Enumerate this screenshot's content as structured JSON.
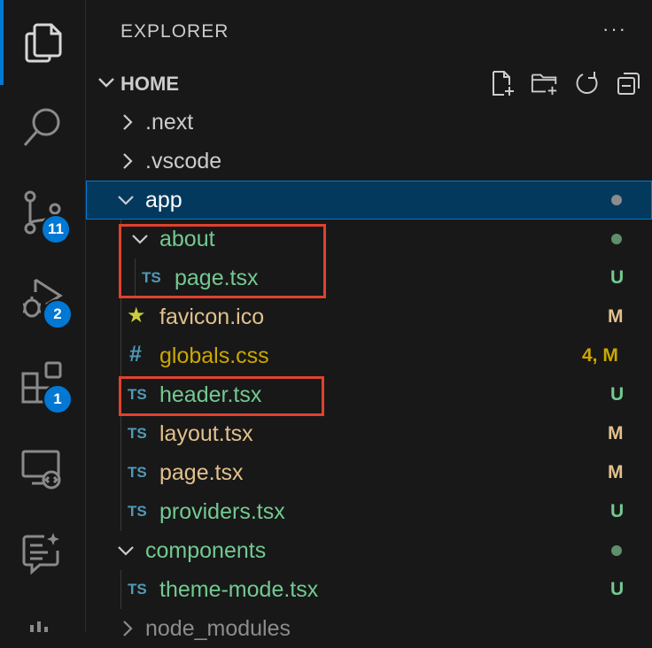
{
  "activity_bar": {
    "items": [
      {
        "name": "explorer",
        "icon": "files-icon",
        "badge": null,
        "active": true
      },
      {
        "name": "search",
        "icon": "search-icon",
        "badge": null
      },
      {
        "name": "source-control",
        "icon": "source-control-icon",
        "badge": "11"
      },
      {
        "name": "run-debug",
        "icon": "run-debug-icon",
        "badge": "2"
      },
      {
        "name": "extensions",
        "icon": "extensions-icon",
        "badge": "1"
      },
      {
        "name": "remote-explorer",
        "icon": "remote-explorer-icon",
        "badge": null
      },
      {
        "name": "chat",
        "icon": "chat-sparkle-icon",
        "badge": null
      }
    ]
  },
  "sidebar": {
    "title": "EXPLORER",
    "more": "···",
    "section": {
      "title": "HOME",
      "actions": [
        "new-file-icon",
        "new-folder-icon",
        "refresh-icon",
        "collapse-all-icon"
      ]
    },
    "tree": [
      {
        "label": ".next",
        "type": "folder",
        "expanded": false,
        "depth": 0,
        "color": "#cccccc"
      },
      {
        "label": ".vscode",
        "type": "folder",
        "expanded": false,
        "depth": 0,
        "color": "#cccccc"
      },
      {
        "label": "app",
        "type": "folder",
        "expanded": true,
        "depth": 0,
        "color": "#cccccc",
        "selected": true,
        "decoration_dot": "#8c8c8c"
      },
      {
        "label": "about",
        "type": "folder",
        "expanded": true,
        "depth": 1,
        "color": "#73c991",
        "decoration_dot": "#5f8f6a"
      },
      {
        "label": "page.tsx",
        "type": "ts",
        "file_icon": "TS",
        "depth": 2,
        "color": "#73c991",
        "status": "U"
      },
      {
        "label": "favicon.ico",
        "type": "star",
        "file_icon": "★",
        "depth": 1,
        "color": "#e2c08d",
        "status": "M"
      },
      {
        "label": "globals.css",
        "type": "css",
        "file_icon": "#",
        "depth": 1,
        "color": "#cca700",
        "status": "4, M"
      },
      {
        "label": "header.tsx",
        "type": "ts",
        "file_icon": "TS",
        "depth": 1,
        "color": "#73c991",
        "status": "U"
      },
      {
        "label": "layout.tsx",
        "type": "ts",
        "file_icon": "TS",
        "depth": 1,
        "color": "#e2c08d",
        "status": "M"
      },
      {
        "label": "page.tsx",
        "type": "ts",
        "file_icon": "TS",
        "depth": 1,
        "color": "#e2c08d",
        "status": "M"
      },
      {
        "label": "providers.tsx",
        "type": "ts",
        "file_icon": "TS",
        "depth": 1,
        "color": "#73c991",
        "status": "U"
      },
      {
        "label": "components",
        "type": "folder",
        "expanded": true,
        "depth": 0,
        "color": "#73c991",
        "decoration_dot": "#5f8f6a"
      },
      {
        "label": "theme-mode.tsx",
        "type": "ts",
        "file_icon": "TS",
        "depth": 1,
        "color": "#73c991",
        "status": "U"
      },
      {
        "label": "node_modules",
        "type": "folder",
        "expanded": false,
        "depth": 0,
        "color": "#8c8c8c"
      }
    ]
  },
  "colors": {
    "accent": "#0078d4",
    "untracked": "#73c991",
    "modified": "#e2c08d",
    "warning": "#cca700",
    "annotation": "#e0412f"
  }
}
